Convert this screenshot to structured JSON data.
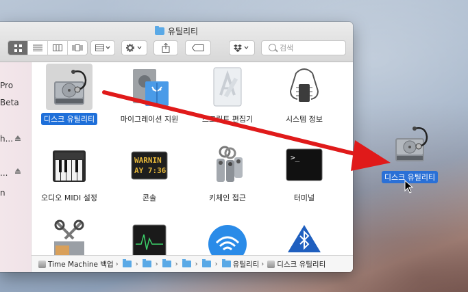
{
  "window": {
    "title": "유틸리티",
    "search_placeholder": "검색"
  },
  "sidebar": {
    "items": [
      {
        "label": "Pro"
      },
      {
        "label": "Beta"
      },
      {
        "label": "h..."
      },
      {
        "label": "..."
      },
      {
        "label": "n"
      }
    ]
  },
  "items": [
    {
      "label": "디스크 유틸리티",
      "icon": "disk-utility-icon",
      "selected": true
    },
    {
      "label": "마이그레이션 지원",
      "icon": "migration-assistant-icon"
    },
    {
      "label": "스크립트 편집기",
      "icon": "script-editor-icon"
    },
    {
      "label": "시스템 정보",
      "icon": "system-information-icon"
    },
    {
      "label": "오디오 MIDI 설정",
      "icon": "audio-midi-icon"
    },
    {
      "label": "콘솔",
      "icon": "console-icon",
      "console_text_1": "WARNIN",
      "console_text_2": "AY 7:36"
    },
    {
      "label": "키체인 접근",
      "icon": "keychain-icon"
    },
    {
      "label": "터미널",
      "icon": "terminal-icon",
      "prompt": ">_"
    },
    {
      "label": "",
      "icon": "grapher-icon"
    },
    {
      "label": "",
      "icon": "activity-monitor-icon"
    },
    {
      "label": "",
      "icon": "airport-utility-icon"
    },
    {
      "label": "",
      "icon": "bluetooth-file-exchange-icon"
    }
  ],
  "pathbar": {
    "root": "Time Machine 백업",
    "current_folder": "유틸리티",
    "current_item": "디스크 유틸리티"
  },
  "drag": {
    "label": "디스크 유틸리티"
  },
  "colors": {
    "selection": "#1e6fd9",
    "arrow": "#e01a1a",
    "folder": "#5aa9e6"
  }
}
